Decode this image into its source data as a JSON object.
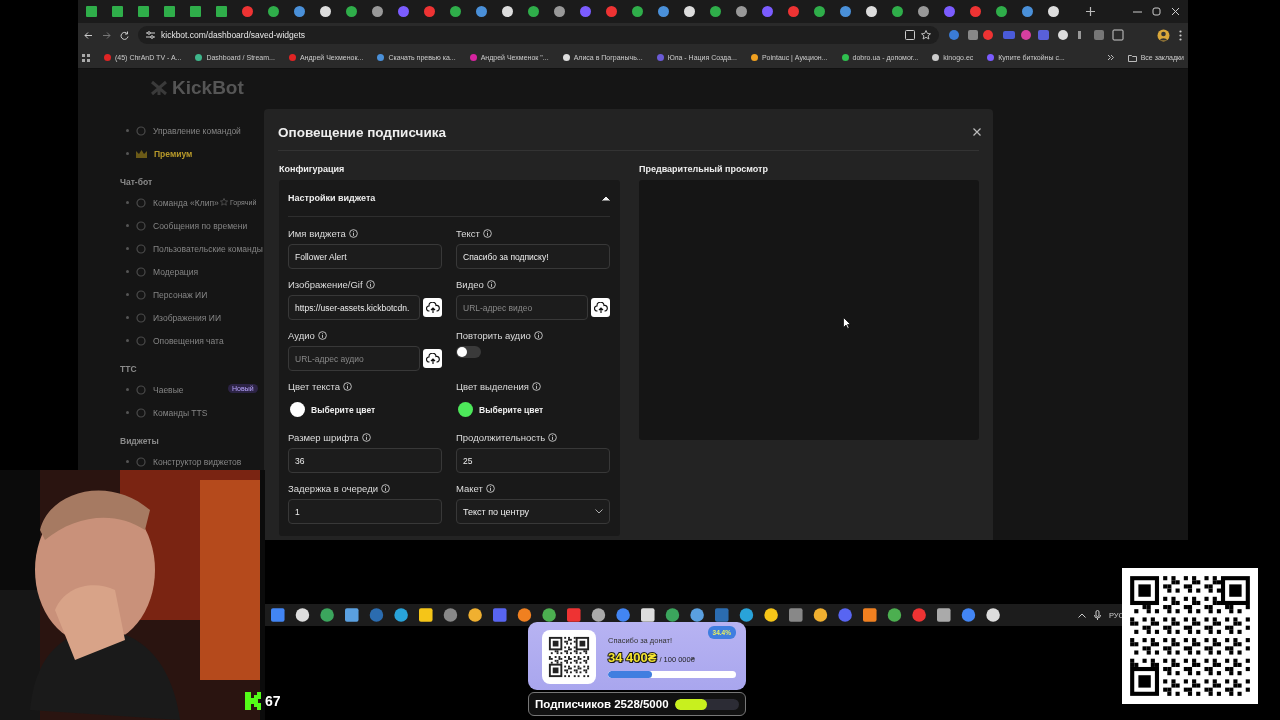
{
  "browser": {
    "url": "kickbot.com/dashboard/saved-widgets",
    "bookmarks": [
      {
        "label": "(45) ChrAnD TV - A...",
        "color": "#e02424"
      },
      {
        "label": "Dashboard / Stream...",
        "color": "#3fb68b"
      },
      {
        "label": "Андрей Чехменок...",
        "color": "#e02424"
      },
      {
        "label": "Скачать превью ка...",
        "color": "#4a90d9"
      },
      {
        "label": "Андрей Чехменок \"...",
        "color": "#d6249f"
      },
      {
        "label": "Алиса в Погранычь...",
        "color": "#dddddd"
      },
      {
        "label": "Юла - Нация Созда...",
        "color": "#6b5bd6"
      },
      {
        "label": "Pointauc | Аукцион...",
        "color": "#f0a020"
      },
      {
        "label": "dobro.ua - допомог...",
        "color": "#2fbf4f"
      },
      {
        "label": "kinogo.ec",
        "color": "#cccccc"
      },
      {
        "label": "Купите биткойны с...",
        "color": "#7b5cff"
      }
    ],
    "all_bookmarks": "Все закладки"
  },
  "sidebar": {
    "logo": "KickBot",
    "sections": [
      {
        "items": [
          {
            "label": "Управление командой",
            "kind": "link"
          },
          {
            "label": "Премиум",
            "kind": "premium"
          }
        ]
      },
      {
        "title": "Чат-бот",
        "items": [
          {
            "label": "Команда «Клип»",
            "kind": "link",
            "tag": "Горячий"
          },
          {
            "label": "Сообщения по времени",
            "kind": "link"
          },
          {
            "label": "Пользовательские команды",
            "kind": "link"
          },
          {
            "label": "Модерация",
            "kind": "link"
          },
          {
            "label": "Персонаж ИИ",
            "kind": "link"
          },
          {
            "label": "Изображения ИИ",
            "kind": "link"
          },
          {
            "label": "Оповещения чата",
            "kind": "link"
          }
        ]
      },
      {
        "title": "TTC",
        "items": [
          {
            "label": "Чаевые",
            "kind": "link",
            "badge": "Новый"
          },
          {
            "label": "Команды TTS",
            "kind": "link"
          }
        ]
      },
      {
        "title": "Виджеты",
        "items": [
          {
            "label": "Конструктор виджетов",
            "kind": "link"
          }
        ]
      }
    ]
  },
  "modal": {
    "title": "Оповещение подписчика",
    "config_title": "Конфигурация",
    "preview_title": "Предварительный просмотр",
    "accordion": {
      "title": "Настройки виджета",
      "expanded": true
    },
    "fields": [
      {
        "kind": "text",
        "label": "Имя виджета",
        "value": "Follower Alert"
      },
      {
        "kind": "text",
        "label": "Текст",
        "value": "Спасибо за подписку!"
      },
      {
        "kind": "upload",
        "label": "Изображение/Gif",
        "value": "https://user-assets.kickbotcdn."
      },
      {
        "kind": "upload",
        "label": "Видео",
        "placeholder": "URL-адрес видео"
      },
      {
        "kind": "upload",
        "label": "Аудио",
        "placeholder": "URL-адрес аудио"
      },
      {
        "kind": "toggle",
        "label": "Повторить аудио",
        "on": false
      },
      {
        "kind": "color",
        "label": "Цвет текста",
        "value": "Выберите цвет",
        "color": "#ffffff"
      },
      {
        "kind": "color",
        "label": "Цвет выделения",
        "value": "Выберите цвет",
        "color": "#4de85a"
      },
      {
        "kind": "text",
        "label": "Размер шрифта",
        "value": "36"
      },
      {
        "kind": "text",
        "label": "Продолжительность",
        "value": "25"
      },
      {
        "kind": "text",
        "label": "Задержка в очереди",
        "value": "1"
      },
      {
        "kind": "select",
        "label": "Макет",
        "value": "Текст по центру"
      }
    ]
  },
  "taskbar": {
    "language": "РУС"
  },
  "donation": {
    "caption": "Спасибо за донат!",
    "amount": "34 400₴",
    "goal": "/ 100 000₴",
    "percent": "34.4%",
    "level": 0.344
  },
  "subscribers": {
    "label": "Подписчиков 2528/5000",
    "level": 0.5056
  },
  "counter": {
    "value": "67"
  }
}
